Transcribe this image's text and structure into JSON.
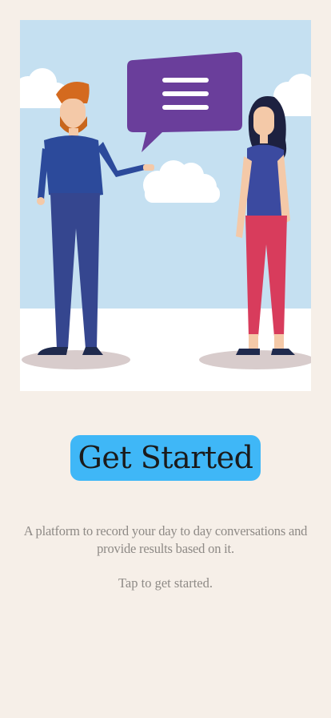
{
  "hero": {
    "image": "two-people-conversation-illustration",
    "icon": "speech-bubble-icon"
  },
  "cta": {
    "label": "Get Started"
  },
  "description": "A platform to record your day to day conversations and provide results based on it.",
  "hint": "Tap to get started.",
  "colors": {
    "background": "#f6efe8",
    "button": "#3fb7f7",
    "sky": "#c5e0f1",
    "bubble": "#6a3e9b",
    "text_muted": "#8e8a86"
  }
}
